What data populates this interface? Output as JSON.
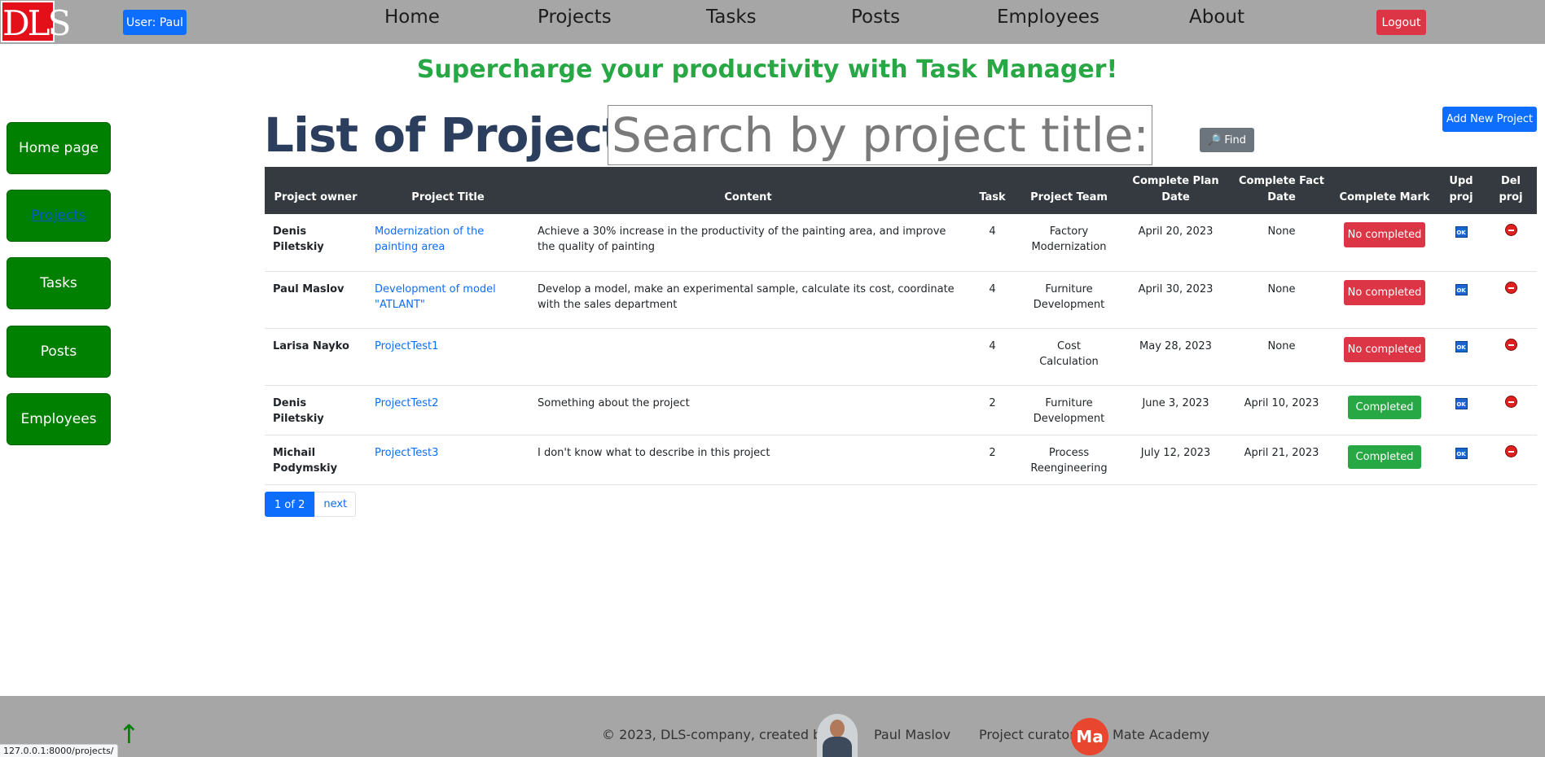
{
  "navbar": {
    "logo_text": "DLS",
    "user_label": "User: Paul",
    "links": [
      "Home",
      "Projects",
      "Tasks",
      "Posts",
      "Employees",
      "About"
    ],
    "logout_label": "Logout"
  },
  "slogan": "Supercharge your productivity with Task Manager!",
  "sidebar": {
    "items": [
      "Home page",
      "Projects",
      "Tasks",
      "Posts",
      "Employees"
    ],
    "active": "Projects"
  },
  "main": {
    "title": "List of Projects",
    "search_placeholder": "Search by project title:",
    "find_label": "Find",
    "add_label": "Add New Project"
  },
  "table": {
    "headers": [
      "Project owner",
      "Project Title",
      "Content",
      "Task",
      "Project Team",
      "Complete Plan Date",
      "Complete Fact Date",
      "Complete Mark",
      "Upd proj",
      "Del proj"
    ],
    "rows": [
      {
        "owner": "Denis Piletskiy",
        "title": "Modernization of the painting area",
        "content": "Achieve a 30% increase in the productivity of the painting area, and improve the quality of painting",
        "task": "4",
        "team": "Factory Modernization",
        "plan": "April 20, 2023",
        "fact": "None",
        "mark": "No completed",
        "completed": false
      },
      {
        "owner": "Paul Maslov",
        "title": "Development of model \"ATLANT\"",
        "content": "Develop a model, make an experimental sample, calculate its cost, coordinate with the sales department",
        "task": "4",
        "team": "Furniture Development",
        "plan": "April 30, 2023",
        "fact": "None",
        "mark": "No completed",
        "completed": false
      },
      {
        "owner": "Larisa Nayko",
        "title": "ProjectTest1",
        "content": "",
        "task": "4",
        "team": "Cost Calculation",
        "plan": "May 28, 2023",
        "fact": "None",
        "mark": "No completed",
        "completed": false
      },
      {
        "owner": "Denis Piletskiy",
        "title": "ProjectTest2",
        "content": "Something about the project",
        "task": "2",
        "team": "Furniture Development",
        "plan": "June 3, 2023",
        "fact": "April 10, 2023",
        "mark": "Completed",
        "completed": true
      },
      {
        "owner": "Michail Podymskiy",
        "title": "ProjectTest3",
        "content": "I don't know what to describe in this project",
        "task": "2",
        "team": "Process Reengineering",
        "plan": "July 12, 2023",
        "fact": "April 21, 2023",
        "mark": "Completed",
        "completed": true
      }
    ],
    "upd_icon_text": "OK"
  },
  "pagination": {
    "current": "1 of 2",
    "next": "next"
  },
  "footer": {
    "copyright": "© 2023, DLS-company, created by",
    "author": "Paul Maslov",
    "curator_label": "Project curator:",
    "curator_logo": "Ma",
    "curator_name": "Mate Academy",
    "up_arrow": "↑"
  },
  "status_url": "127.0.0.1:8000/projects/",
  "colors": {
    "navbar": "#a6a6a6",
    "sidebar_button": "#008000",
    "slogan": "#28a745",
    "title": "#2b3e5e",
    "table_header": "#343a40",
    "link": "#0d6efd",
    "danger": "#dc3545",
    "success": "#28a745"
  }
}
